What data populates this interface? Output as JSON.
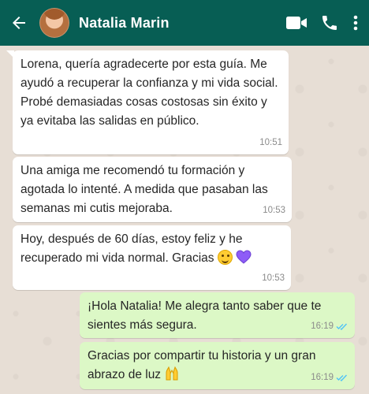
{
  "header": {
    "contact_name": "Natalia Marin"
  },
  "messages": [
    {
      "direction": "in",
      "text": "Lorena, quería agradecerte por esta guía. Me ayudó a recuperar la confianza y mi vida social. Probé demasiadas cosas costosas sin éxito y ya evitaba las salidas en público.",
      "time": "10:51"
    },
    {
      "direction": "in",
      "text": "Una amiga me recomendó tu formación y agotada lo intenté. A medida que pasaban las semanas mi cutis mejoraba.",
      "time": "10:53"
    },
    {
      "direction": "in",
      "text": "Hoy, después de 60 días, estoy feliz y he recuperado mi vida normal. Gracias",
      "time": "10:53",
      "emojis": [
        "smiling-face-emoji",
        "purple-heart-emoji"
      ]
    },
    {
      "direction": "out",
      "text": "¡Hola Natalia! Me alegra tanto saber que te sientes más segura.",
      "time": "16:19",
      "status": "read"
    },
    {
      "direction": "out",
      "text": "Gracias por compartir tu historia y un gran abrazo de luz",
      "time": "16:19",
      "status": "read",
      "emojis": [
        "raised-hands-emoji"
      ]
    }
  ],
  "colors": {
    "header_bg": "#075e54",
    "incoming_bubble": "#ffffff",
    "outgoing_bubble": "#dcf8c6",
    "read_ticks": "#4fc3f7",
    "chat_bg": "#e7ded5"
  }
}
